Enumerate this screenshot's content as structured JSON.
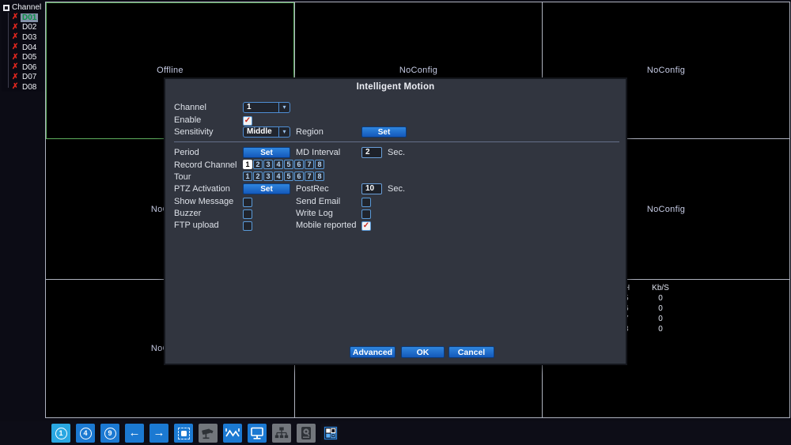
{
  "icons": {
    "dropdown_arrow": "▾",
    "arrow_left": "←",
    "arrow_right": "→",
    "x_mark": "✗",
    "check_mark": "✓"
  },
  "channel_tree": {
    "header": "Channel",
    "items": [
      {
        "label": "D01",
        "selected": true
      },
      {
        "label": "D02",
        "selected": false
      },
      {
        "label": "D03",
        "selected": false
      },
      {
        "label": "D04",
        "selected": false
      },
      {
        "label": "D05",
        "selected": false
      },
      {
        "label": "D06",
        "selected": false
      },
      {
        "label": "D07",
        "selected": false
      },
      {
        "label": "D08",
        "selected": false
      }
    ]
  },
  "grid": {
    "labels": {
      "cell1": "Offline",
      "cell2": "NoConfig",
      "cell3": "NoConfig",
      "cell4": "NoConfig",
      "cell5": "",
      "cell6": "NoConfig",
      "cell7": "NoConfig",
      "cell8": "",
      "cell9": ""
    },
    "bitrate": {
      "col_ch": "H",
      "col_kbs": "Kb/S",
      "rows": [
        {
          "ch": "5",
          "kbs": "0"
        },
        {
          "ch": "6",
          "kbs": "0"
        },
        {
          "ch": "7",
          "kbs": "0"
        },
        {
          "ch": "8",
          "kbs": "0"
        }
      ]
    }
  },
  "dialog": {
    "title": "Intelligent Motion",
    "channel_label": "Channel",
    "channel_value": "1",
    "enable_label": "Enable",
    "enable_checked": true,
    "sensitivity_label": "Sensitivity",
    "sensitivity_value": "Middle",
    "region_label": "Region",
    "region_set_label": "Set",
    "period_label": "Period",
    "period_set_label": "Set",
    "md_interval_label": "MD Interval",
    "md_interval_value": "2",
    "md_interval_unit": "Sec.",
    "record_channel_label": "Record Channel",
    "record_channels": [
      "1",
      "2",
      "3",
      "4",
      "5",
      "6",
      "7",
      "8"
    ],
    "record_channel_active": "1",
    "tour_label": "Tour",
    "tour_channels": [
      "1",
      "2",
      "3",
      "4",
      "5",
      "6",
      "7",
      "8"
    ],
    "ptz_label": "PTZ Activation",
    "ptz_set_label": "Set",
    "postrec_label": "PostRec",
    "postrec_value": "10",
    "postrec_unit": "Sec.",
    "show_message_label": "Show Message",
    "show_message_checked": false,
    "send_email_label": "Send Email",
    "send_email_checked": false,
    "buzzer_label": "Buzzer",
    "buzzer_checked": false,
    "write_log_label": "Write Log",
    "write_log_checked": false,
    "ftp_upload_label": "FTP upload",
    "ftp_upload_checked": false,
    "mobile_reported_label": "Mobile reported",
    "mobile_reported_checked": true,
    "buttons": {
      "advanced": "Advanced",
      "ok": "OK",
      "cancel": "Cancel"
    }
  },
  "toolbar": {
    "view1_label": "1",
    "view4_label": "4",
    "view9_label": "9",
    "icon_names": [
      "single-view",
      "quad-view",
      "nine-view",
      "previous",
      "next",
      "record",
      "ptz-camera",
      "color-adjust",
      "display",
      "network",
      "disk-search",
      "multi-screen"
    ]
  },
  "colors": {
    "accent_blue": "#1b79d2",
    "highlight_cyan": "#2aa7e2",
    "selected_green": "#5fae5f",
    "alert_red": "#e0261e",
    "dialog_bg": "#31353f",
    "grid_line": "#aeb2bf"
  }
}
